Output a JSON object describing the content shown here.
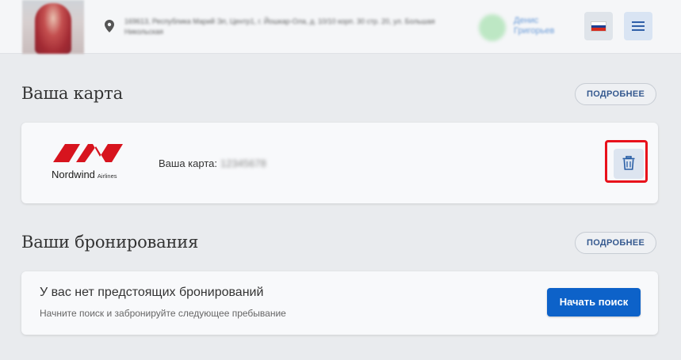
{
  "header": {
    "address": "169613, Республика Марий Эл, Центр1, г. Йошкар-Ола, д. 10/10 корп. 30 стр. 20, ул. Большая Никольская",
    "user_name": "Денис Григорьев",
    "flag_icon": "russia-flag-icon",
    "menu_icon": "menu-icon"
  },
  "card_section": {
    "title": "Ваша карта",
    "more_label": "ПОДРОБНЕЕ",
    "logo_brand": "Nordwind",
    "logo_suffix": "Airlines",
    "card_label": "Ваша карта:",
    "card_number": "12345678",
    "delete_icon": "trash-icon"
  },
  "bookings_section": {
    "title": "Ваши бронирования",
    "more_label": "ПОДРОБНЕЕ",
    "empty_title": "У вас нет предстоящих бронирований",
    "empty_subtitle": "Начните поиск и забронируйте следующее пребывание",
    "search_label": "Начать поиск"
  },
  "colors": {
    "accent": "#0d62c9",
    "brand_red": "#d7141e",
    "highlight": "#e8111b"
  }
}
